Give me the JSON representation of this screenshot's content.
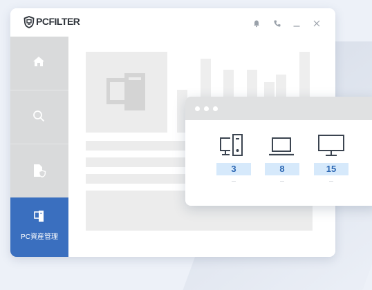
{
  "app": {
    "brand": "PCFILTER",
    "icons": [
      "shield-logo-icon",
      "bell-icon",
      "phone-icon",
      "minimize-icon",
      "close-icon"
    ]
  },
  "sidebar": {
    "items": [
      {
        "icon": "home-icon",
        "label": ""
      },
      {
        "icon": "search-icon",
        "label": ""
      },
      {
        "icon": "document-shield-icon",
        "label": ""
      },
      {
        "icon": "pc-assets-icon",
        "label": "PC資産管理",
        "active": true
      }
    ]
  },
  "popup": {
    "devices": [
      {
        "icon": "desktop-tower-icon",
        "count": "3"
      },
      {
        "icon": "laptop-icon",
        "count": "8"
      },
      {
        "icon": "monitor-icon",
        "count": "15"
      }
    ]
  },
  "colors": {
    "accent": "#3a6fbf",
    "count_bg": "#d6e9fb",
    "count_text": "#2c67b3",
    "sidebar_bg": "#d9dadb",
    "background": "#edf1f8"
  }
}
